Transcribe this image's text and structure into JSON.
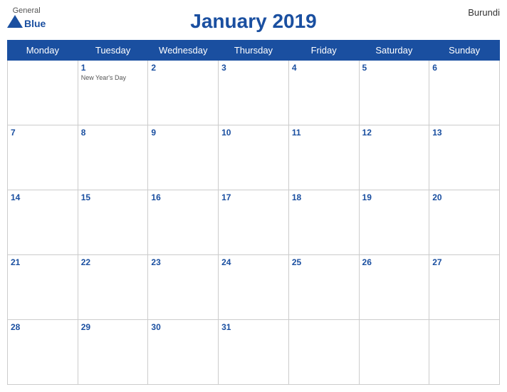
{
  "header": {
    "logo": {
      "general": "General",
      "blue": "Blue",
      "bird_symbol": "▲"
    },
    "title": "January 2019",
    "country": "Burundi"
  },
  "weekdays": [
    "Monday",
    "Tuesday",
    "Wednesday",
    "Thursday",
    "Friday",
    "Saturday",
    "Sunday"
  ],
  "weeks": [
    [
      {
        "day": null,
        "holiday": null
      },
      {
        "day": "1",
        "holiday": "New Year's Day"
      },
      {
        "day": "2",
        "holiday": null
      },
      {
        "day": "3",
        "holiday": null
      },
      {
        "day": "4",
        "holiday": null
      },
      {
        "day": "5",
        "holiday": null
      },
      {
        "day": "6",
        "holiday": null
      }
    ],
    [
      {
        "day": "7",
        "holiday": null
      },
      {
        "day": "8",
        "holiday": null
      },
      {
        "day": "9",
        "holiday": null
      },
      {
        "day": "10",
        "holiday": null
      },
      {
        "day": "11",
        "holiday": null
      },
      {
        "day": "12",
        "holiday": null
      },
      {
        "day": "13",
        "holiday": null
      }
    ],
    [
      {
        "day": "14",
        "holiday": null
      },
      {
        "day": "15",
        "holiday": null
      },
      {
        "day": "16",
        "holiday": null
      },
      {
        "day": "17",
        "holiday": null
      },
      {
        "day": "18",
        "holiday": null
      },
      {
        "day": "19",
        "holiday": null
      },
      {
        "day": "20",
        "holiday": null
      }
    ],
    [
      {
        "day": "21",
        "holiday": null
      },
      {
        "day": "22",
        "holiday": null
      },
      {
        "day": "23",
        "holiday": null
      },
      {
        "day": "24",
        "holiday": null
      },
      {
        "day": "25",
        "holiday": null
      },
      {
        "day": "26",
        "holiday": null
      },
      {
        "day": "27",
        "holiday": null
      }
    ],
    [
      {
        "day": "28",
        "holiday": null
      },
      {
        "day": "29",
        "holiday": null
      },
      {
        "day": "30",
        "holiday": null
      },
      {
        "day": "31",
        "holiday": null
      },
      {
        "day": null,
        "holiday": null
      },
      {
        "day": null,
        "holiday": null
      },
      {
        "day": null,
        "holiday": null
      }
    ]
  ]
}
